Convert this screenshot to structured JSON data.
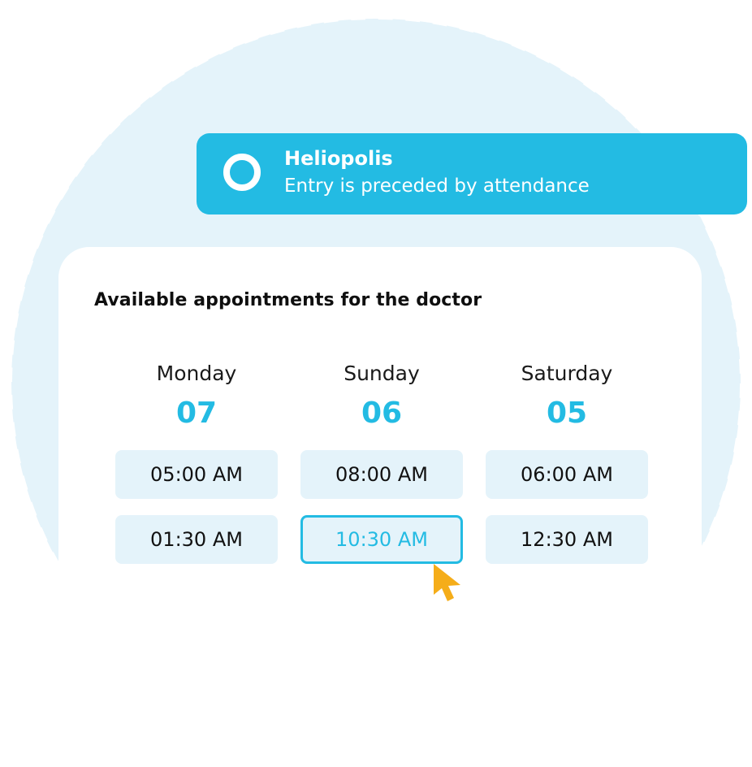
{
  "colors": {
    "accent": "#23bbe3",
    "slot_bg": "#e4f3fa",
    "circle_bg": "#e4f3fa",
    "cursor": "#f5ad19"
  },
  "location": {
    "icon": "radio-ring-icon",
    "name": "Heliopolis",
    "note": "Entry is preceded by attendance"
  },
  "appointments": {
    "title": "Available appointments for the doctor",
    "days": [
      {
        "name": "Monday",
        "date": "07",
        "slots": [
          "05:00 AM",
          "01:30 AM"
        ]
      },
      {
        "name": "Sunday",
        "date": "06",
        "slots": [
          "08:00 AM",
          "10:30 AM"
        ]
      },
      {
        "name": "Saturday",
        "date": "05",
        "slots": [
          "06:00 AM",
          "12:30 AM"
        ]
      }
    ],
    "selected_slot": "10:30 AM"
  },
  "cursor_icon": "pointer-arrow-icon"
}
